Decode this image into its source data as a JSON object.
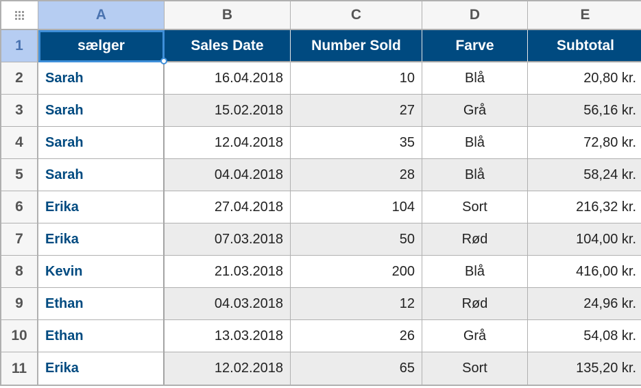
{
  "columns": [
    "A",
    "B",
    "C",
    "D",
    "E"
  ],
  "selectedColumn": "A",
  "selectedRow": 1,
  "headerRow": {
    "seller": "sælger",
    "date": "Sales Date",
    "number": "Number Sold",
    "color": "Farve",
    "subtotal": "Subtotal"
  },
  "rows": [
    {
      "n": 2,
      "seller": "Sarah",
      "date": "16.04.2018",
      "num": "10",
      "color": "Blå",
      "sub": "20,80 kr."
    },
    {
      "n": 3,
      "seller": "Sarah",
      "date": "15.02.2018",
      "num": "27",
      "color": "Grå",
      "sub": "56,16 kr."
    },
    {
      "n": 4,
      "seller": "Sarah",
      "date": "12.04.2018",
      "num": "35",
      "color": "Blå",
      "sub": "72,80 kr."
    },
    {
      "n": 5,
      "seller": "Sarah",
      "date": "04.04.2018",
      "num": "28",
      "color": "Blå",
      "sub": "58,24 kr."
    },
    {
      "n": 6,
      "seller": "Erika",
      "date": "27.04.2018",
      "num": "104",
      "color": "Sort",
      "sub": "216,32 kr."
    },
    {
      "n": 7,
      "seller": "Erika",
      "date": "07.03.2018",
      "num": "50",
      "color": "Rød",
      "sub": "104,00 kr."
    },
    {
      "n": 8,
      "seller": "Kevin",
      "date": "21.03.2018",
      "num": "200",
      "color": "Blå",
      "sub": "416,00 kr."
    },
    {
      "n": 9,
      "seller": "Ethan",
      "date": "04.03.2018",
      "num": "12",
      "color": "Rød",
      "sub": "24,96 kr."
    },
    {
      "n": 10,
      "seller": "Ethan",
      "date": "13.03.2018",
      "num": "26",
      "color": "Grå",
      "sub": "54,08 kr."
    },
    {
      "n": 11,
      "seller": "Erika",
      "date": "12.02.2018",
      "num": "65",
      "color": "Sort",
      "sub": "135,20 kr."
    }
  ]
}
